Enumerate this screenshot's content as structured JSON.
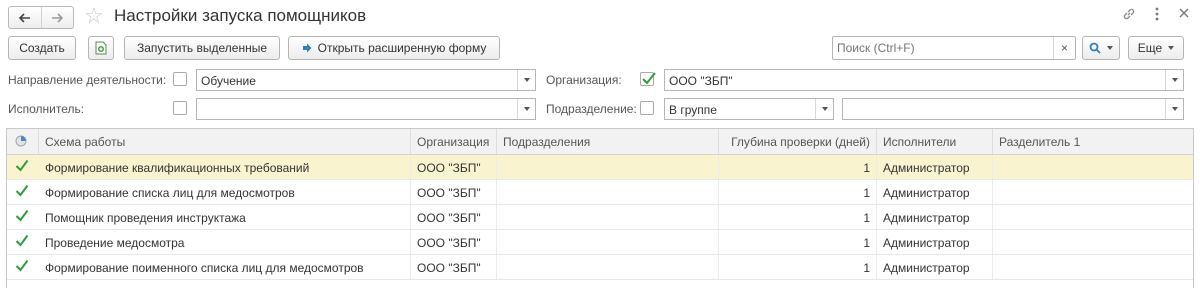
{
  "window": {
    "title": "Настройки запуска помощников",
    "nav": {
      "back_icon": "arrow-left-icon",
      "forward_icon": "arrow-right-icon"
    },
    "favorite_icon": "star-icon",
    "icons": [
      "link-icon",
      "more-vertical-icon",
      "close-icon"
    ]
  },
  "toolbar": {
    "create_label": "Создать",
    "launch_selected_label": "Запустить выделенные",
    "open_extended_label": "Открыть расширенную форму",
    "search_placeholder": "Поиск (Ctrl+F)",
    "search_clear": "×",
    "more_label": "Еще"
  },
  "filters": {
    "direction": {
      "label": "Направление деятельности:",
      "checked": false,
      "value": "Обучение"
    },
    "organization": {
      "label": "Организация:",
      "checked": true,
      "value": "ООО \"ЗБП\""
    },
    "executor": {
      "label": "Исполнитель:",
      "checked": false,
      "value": ""
    },
    "department": {
      "label": "Подразделение:",
      "checked": false,
      "mode": "В группе",
      "value": ""
    }
  },
  "table": {
    "columns": [
      "Схема работы",
      "Организация",
      "Подразделения",
      "Глубина проверки (дней)",
      "Исполнители",
      "Разделитель 1"
    ],
    "rows": [
      {
        "checked": true,
        "scheme": "Формирование квалификационных требований",
        "org": "ООО \"ЗБП\"",
        "dept": "",
        "depth": "1",
        "executor": "Администратор",
        "sep": "",
        "selected": true
      },
      {
        "checked": true,
        "scheme": "Формирование списка лиц для медосмотров",
        "org": "ООО \"ЗБП\"",
        "dept": "",
        "depth": "1",
        "executor": "Администратор",
        "sep": "",
        "selected": false
      },
      {
        "checked": true,
        "scheme": "Помощник проведения инструктажа",
        "org": "ООО \"ЗБП\"",
        "dept": "",
        "depth": "1",
        "executor": "Администратор",
        "sep": "",
        "selected": false
      },
      {
        "checked": true,
        "scheme": "Проведение медосмотра",
        "org": "ООО \"ЗБП\"",
        "dept": "",
        "depth": "1",
        "executor": "Администратор",
        "sep": "",
        "selected": false
      },
      {
        "checked": true,
        "scheme": "Формирование поименного списка лиц для медосмотров",
        "org": "ООО \"ЗБП\"",
        "dept": "",
        "depth": "1",
        "executor": "Администратор",
        "sep": "",
        "selected": false
      }
    ]
  },
  "colors": {
    "check_green": "#2e9e3a",
    "selected_row": "#faf3cf",
    "header_bg": "#f2f2f2",
    "accent_blue": "#2f7fc1"
  }
}
